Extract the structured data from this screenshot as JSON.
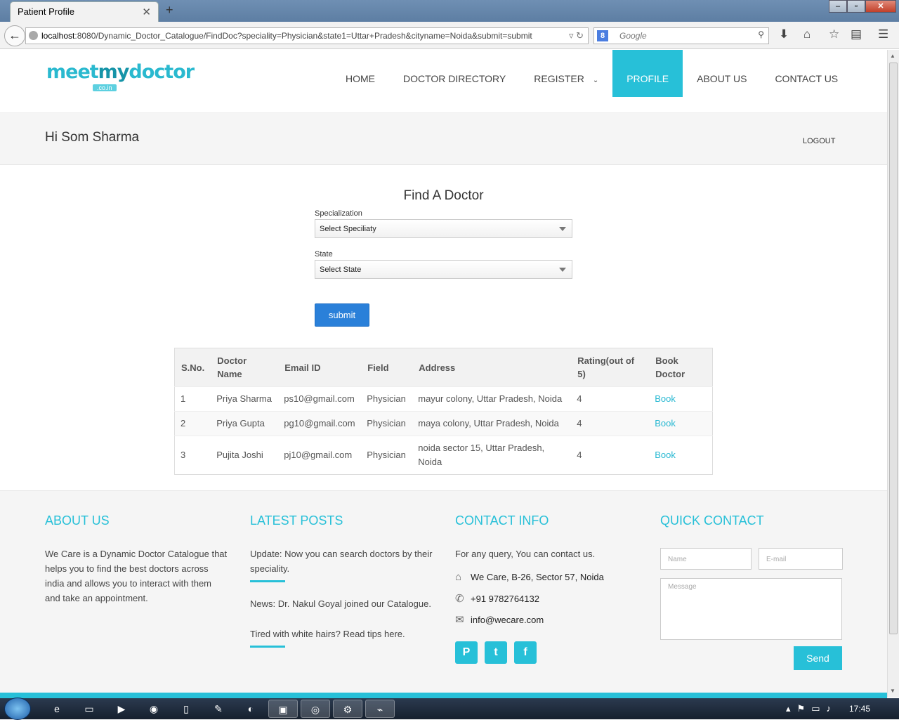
{
  "browser": {
    "tab_title": "Patient Profile",
    "tab_close": "✕",
    "new_tab": "+",
    "url_host": "localhost",
    "url_rest": ":8080/Dynamic_Doctor_Catalogue/FindDoc?speciality=Physician&state1=Uttar+Pradesh&cityname=Noida&submit=submit",
    "search_placeholder": "Google",
    "search_engine_badge": "8"
  },
  "site": {
    "logo_text_a": "meet",
    "logo_text_b": "my",
    "logo_text_c": "doctor",
    "logo_sub": ".co.in",
    "nav": {
      "home": "HOME",
      "directory": "DOCTOR DIRECTORY",
      "register": "REGISTER",
      "profile": "PROFILE",
      "about": "ABOUT US",
      "contact": "CONTACT US"
    },
    "greeting": "Hi Som Sharma",
    "logout": "LOGOUT"
  },
  "find": {
    "title": "Find A Doctor",
    "specialization_label": "Specialization",
    "specialization_value": "Select Speciliaty",
    "state_label": "State",
    "state_value": "Select State",
    "submit": "submit"
  },
  "results": {
    "headers": {
      "sno": "S.No.",
      "name": "Doctor Name",
      "email": "Email ID",
      "field": "Field",
      "address": "Address",
      "rating": "Rating(out of 5)",
      "book": "Book Doctor"
    },
    "rows": [
      {
        "sno": "1",
        "name": "Priya Sharma",
        "email": "ps10@gmail.com",
        "field": "Physician",
        "address": "mayur colony, Uttar Pradesh, Noida",
        "rating": "4",
        "book": "Book"
      },
      {
        "sno": "2",
        "name": "Priya Gupta",
        "email": "pg10@gmail.com",
        "field": "Physician",
        "address": "maya colony, Uttar Pradesh, Noida",
        "rating": "4",
        "book": "Book"
      },
      {
        "sno": "3",
        "name": "Pujita Joshi",
        "email": "pj10@gmail.com",
        "field": "Physician",
        "address": "noida sector 15, Uttar Pradesh, Noida",
        "rating": "4",
        "book": "Book"
      }
    ]
  },
  "footer": {
    "about_title": "ABOUT US",
    "about_text": "We Care is a Dynamic Doctor Catalogue that helps you to find the best doctors across india and allows you to interact with them and take an appointment.",
    "posts_title": "LATEST POSTS",
    "posts": [
      "Update: Now you can search doctors by their speciality.",
      "News: Dr. Nakul Goyal joined our Catalogue.",
      "Tired with white hairs? Read tips here."
    ],
    "contact_title": "CONTACT INFO",
    "contact_intro": "For any query, You can contact us.",
    "address": "We Care, B-26, Sector 57, Noida",
    "phone": "+91 9782764132",
    "email": "info@wecare.com",
    "quick_title": "QUICK CONTACT",
    "name_placeholder": "Name",
    "email_placeholder": "E-mail",
    "message_placeholder": "Message",
    "send": "Send"
  },
  "taskbar": {
    "clock": "17:45"
  },
  "colors": {
    "accent": "#27c0d8",
    "button_blue": "#2a80d9"
  }
}
